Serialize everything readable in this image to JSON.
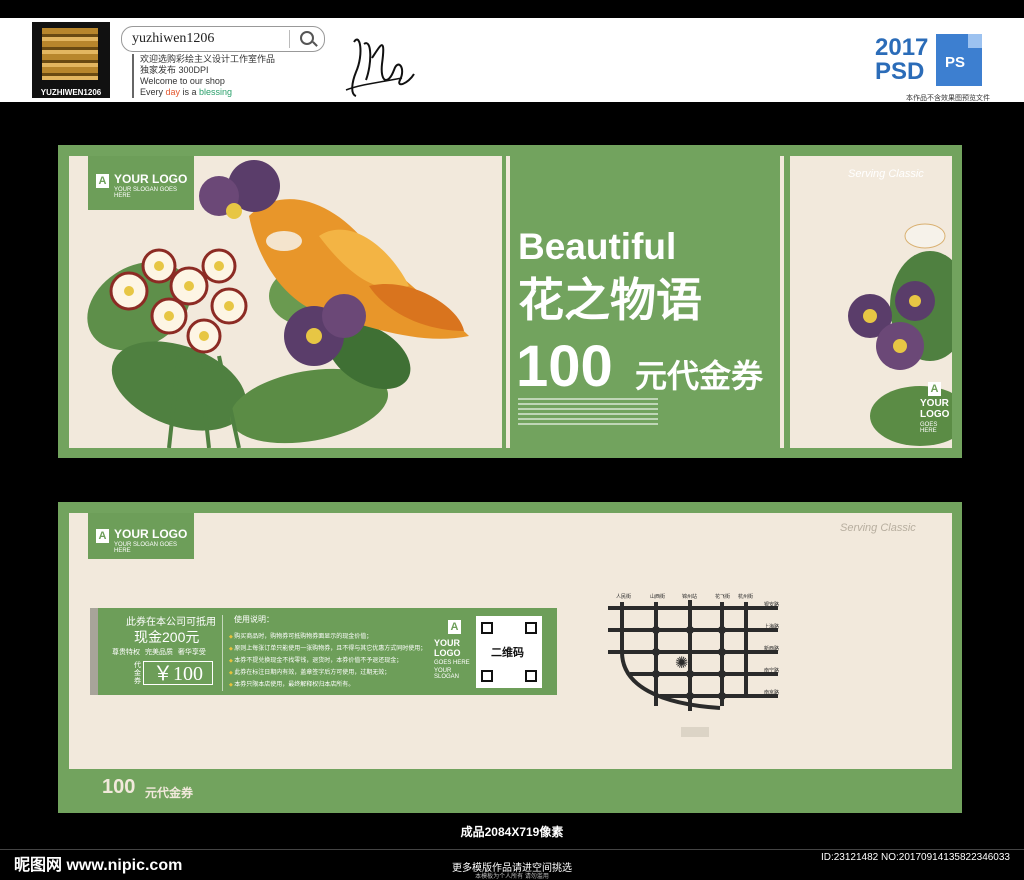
{
  "header": {
    "brand_caption": "YUZHIWEN1206",
    "search_value": "yuzhiwen1206",
    "shop_lines": [
      "欢迎选购彩绘主义设计工作室作品",
      "独家发布 300DPI",
      "Welcome to our shop"
    ],
    "tagline": [
      "Every ",
      "day",
      " is a ",
      "blessing"
    ],
    "tagline_colors": [
      "#333333",
      "#e4572e",
      "#333333",
      "#2aa06b"
    ],
    "psd_year": "2017",
    "psd_label": "PSD",
    "ps_icon_label": "PS",
    "psd_note": "本作品不含效果图预览文件"
  },
  "front": {
    "logo_letter": "A",
    "logo_title": "YOUR LOGO",
    "logo_slogan": "YOUR SLOGAN GOES HERE",
    "title_en": "Beautiful",
    "title_cn": "花之物语",
    "amount": "100",
    "amount_unit": "元代金券",
    "stub_script": "Serving Classic",
    "stub_logo_letter": "A",
    "stub_logo_text": [
      "YOUR",
      "LOGO"
    ],
    "stub_logo_small": "GOES HERE"
  },
  "back": {
    "logo_letter": "A",
    "logo_title": "YOUR LOGO",
    "logo_slogan": "YOUR SLOGAN GOES HERE",
    "script": "Serving Classic",
    "accept_text": "此券在本公司可抵用",
    "cash_text": "现金200元",
    "perks": "尊贵特权 完美品质 奢华享受",
    "voucher_label": "代金券",
    "price": "￥100",
    "usage_title": "使用说明：",
    "rules": [
      "购买商品时，购物券可抵购物券面显示的现金价值；",
      "原则上每张订单只能使用一张购物券，且不得与其它优惠方式同时使用；",
      "本券不提兑换现金不找零钱，退货时，本券价值不予退还现金；",
      "此券在标注日期内有效，盖章签字后方可使用，过期无效；",
      "本券只限本店使用，最终解释权归本店所有。"
    ],
    "vert_logo_letter": "A",
    "vert_logo_text": [
      "YOUR",
      "LOGO"
    ],
    "vert_logo_small": [
      "GOES HERE",
      "YOUR SLOGAN"
    ],
    "qr_label": "二维码",
    "map_labels_top": [
      "人民街",
      "山西街",
      "锦州站",
      "花飞街",
      "杭州街"
    ],
    "map_labels_right": [
      "银安路",
      "上海路",
      "新西路",
      "南宁路",
      "南京路"
    ],
    "amount_num": "100",
    "amount_unit": "元代金券"
  },
  "footer": {
    "size_note": "成品2084X719像素",
    "watermark": "昵图网 www.nipic.com",
    "more_text": "更多模版作品请进空间挑选",
    "copyright": "本模板为个人所有  请勿滥用",
    "id_text": "ID:23121482 NO:20170914135822346033"
  }
}
